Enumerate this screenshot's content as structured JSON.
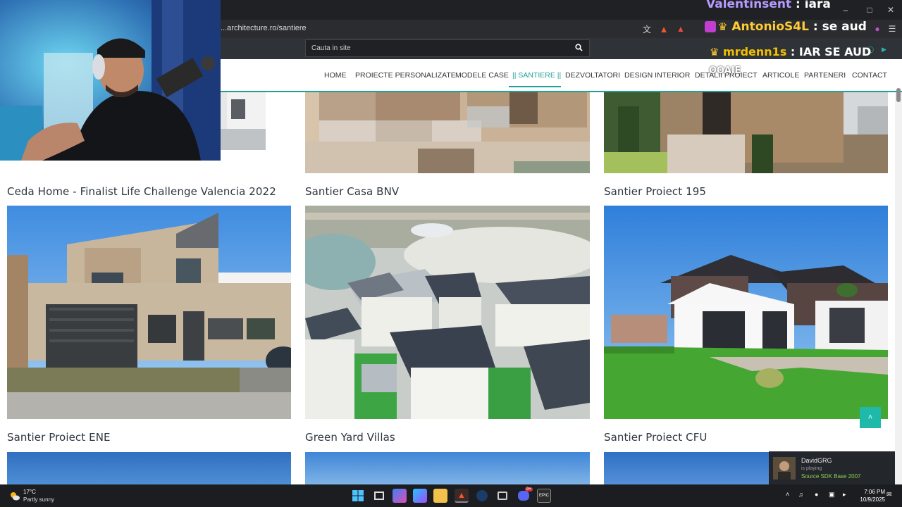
{
  "browser": {
    "url": "...architecture.ro/santiere"
  },
  "site": {
    "search_placeholder": "Cauta in site",
    "nav": [
      {
        "label": "HOME"
      },
      {
        "label": "PROIECTE PERSONALIZATE"
      },
      {
        "label": "MODELE CASE"
      },
      {
        "label": "|| SANTIERE ||",
        "active": true
      },
      {
        "label": "DEZVOLTATORI"
      },
      {
        "label": "DESIGN INTERIOR"
      },
      {
        "label": "DETALII PROIECT"
      },
      {
        "label": "ARTICOLE"
      },
      {
        "label": "PARTENERI"
      },
      {
        "label": "CONTACT"
      }
    ],
    "projects": [
      {
        "title": "Ceda Home - Finalist Life Challenge Valencia 2022"
      },
      {
        "title": "Santier Casa BNV"
      },
      {
        "title": "Santier Proiect 195"
      },
      {
        "title": "Santier Proiect ENE"
      },
      {
        "title": "Green Yard Villas"
      },
      {
        "title": "Santier Proiect CFU"
      }
    ],
    "accent_color": "#1fa296"
  },
  "stream_chat": [
    {
      "user": "Valentinsent",
      "message": " : iara"
    },
    {
      "user": "AntonioS4L",
      "message": " : se aud"
    },
    {
      "user": "mrdenn1s",
      "message": " : IAR SE AUD"
    }
  ],
  "stream_extra_text": "OOAIE",
  "steam_toast": {
    "name": "DavidGRG",
    "status": "is playing",
    "game": "Source SDK Base 2007"
  },
  "taskbar": {
    "temp": "17°C",
    "weather": "Partly sunny",
    "time": "7:06 PM",
    "date": "10/9/2025",
    "discord_badge": "9+"
  }
}
